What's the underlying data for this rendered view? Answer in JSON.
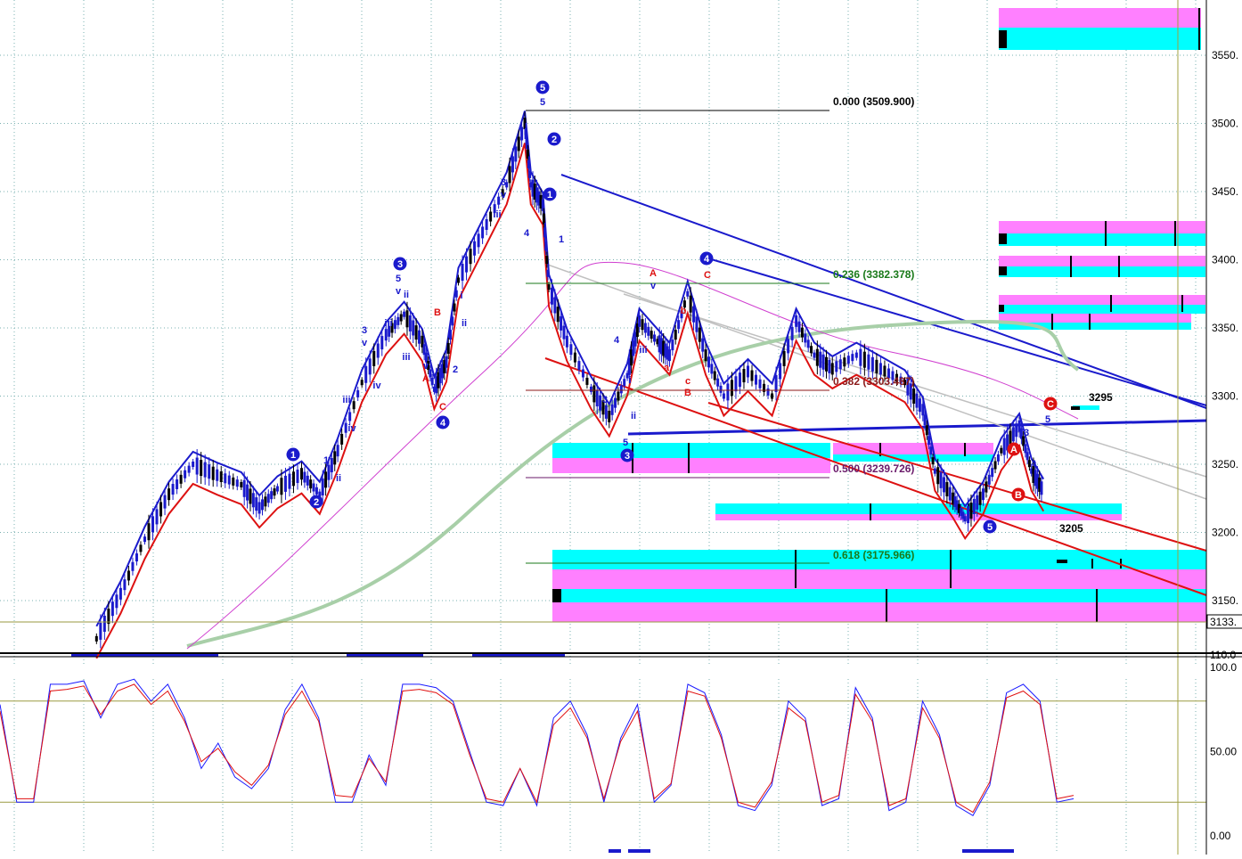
{
  "chart_data": [
    {
      "type": "candlestick",
      "title": "",
      "xlabel": "",
      "ylabel": "",
      "ylim": [
        3118,
        3585
      ],
      "y_ticks": [
        "3550.",
        "3500.",
        "3450.",
        "3400.",
        "3350.",
        "3300.",
        "3250.",
        "3200.",
        "3150."
      ],
      "y_tick_values": [
        3550,
        3500,
        3450,
        3400,
        3350,
        3300,
        3250,
        3200,
        3150
      ],
      "grid": "dotted",
      "current_price_label": "3133.",
      "current_price": 3133,
      "price_series": [
        {
          "x": 0.08,
          "y": 3122
        },
        {
          "x": 0.1,
          "y": 3155
        },
        {
          "x": 0.12,
          "y": 3195
        },
        {
          "x": 0.14,
          "y": 3228
        },
        {
          "x": 0.16,
          "y": 3250
        },
        {
          "x": 0.18,
          "y": 3242
        },
        {
          "x": 0.2,
          "y": 3235
        },
        {
          "x": 0.215,
          "y": 3218
        },
        {
          "x": 0.23,
          "y": 3232
        },
        {
          "x": 0.25,
          "y": 3243
        },
        {
          "x": 0.265,
          "y": 3228
        },
        {
          "x": 0.28,
          "y": 3260
        },
        {
          "x": 0.3,
          "y": 3310
        },
        {
          "x": 0.32,
          "y": 3345
        },
        {
          "x": 0.335,
          "y": 3360
        },
        {
          "x": 0.35,
          "y": 3340
        },
        {
          "x": 0.36,
          "y": 3305
        },
        {
          "x": 0.37,
          "y": 3325
        },
        {
          "x": 0.38,
          "y": 3385
        },
        {
          "x": 0.4,
          "y": 3420
        },
        {
          "x": 0.42,
          "y": 3455
        },
        {
          "x": 0.435,
          "y": 3500
        },
        {
          "x": 0.44,
          "y": 3455
        },
        {
          "x": 0.45,
          "y": 3440
        },
        {
          "x": 0.455,
          "y": 3380
        },
        {
          "x": 0.47,
          "y": 3340
        },
        {
          "x": 0.49,
          "y": 3305
        },
        {
          "x": 0.505,
          "y": 3285
        },
        {
          "x": 0.52,
          "y": 3315
        },
        {
          "x": 0.53,
          "y": 3355
        },
        {
          "x": 0.545,
          "y": 3340
        },
        {
          "x": 0.555,
          "y": 3330
        },
        {
          "x": 0.57,
          "y": 3375
        },
        {
          "x": 0.585,
          "y": 3330
        },
        {
          "x": 0.6,
          "y": 3300
        },
        {
          "x": 0.62,
          "y": 3318
        },
        {
          "x": 0.64,
          "y": 3300
        },
        {
          "x": 0.66,
          "y": 3355
        },
        {
          "x": 0.675,
          "y": 3330
        },
        {
          "x": 0.69,
          "y": 3320
        },
        {
          "x": 0.71,
          "y": 3330
        },
        {
          "x": 0.73,
          "y": 3320
        },
        {
          "x": 0.75,
          "y": 3310
        },
        {
          "x": 0.765,
          "y": 3290
        },
        {
          "x": 0.775,
          "y": 3245
        },
        {
          "x": 0.79,
          "y": 3225
        },
        {
          "x": 0.8,
          "y": 3210
        },
        {
          "x": 0.815,
          "y": 3228
        },
        {
          "x": 0.83,
          "y": 3260
        },
        {
          "x": 0.845,
          "y": 3278
        },
        {
          "x": 0.855,
          "y": 3245
        },
        {
          "x": 0.865,
          "y": 3230
        }
      ],
      "fib_levels": [
        {
          "label": "0.000 (3509.900)",
          "value": 3509.9,
          "color": "#000000"
        },
        {
          "label": "0.236 (3382.378)",
          "value": 3382.378,
          "color": "#1a7a1a"
        },
        {
          "label": "0.382 (3303.487)",
          "value": 3303.487,
          "color": "#8b1a1a"
        },
        {
          "label": "0.500 (3239.726)",
          "value": 3239.726,
          "color": "#6a1a6a"
        },
        {
          "label": "0.618 (3175.966)",
          "value": 3175.966,
          "color": "#1a7a1a"
        }
      ],
      "annotations": [
        "3295",
        "3205"
      ],
      "wave_labels": [
        "1",
        "2",
        "3",
        "4",
        "5",
        "i",
        "ii",
        "iii",
        "iv",
        "v",
        "A",
        "B",
        "C",
        "a",
        "b",
        "c"
      ]
    },
    {
      "type": "line",
      "title": "",
      "ylim": [
        -6,
        106
      ],
      "y_ticks": [
        "100.0",
        "50.00",
        "0.00"
      ],
      "y_tick_values": [
        100,
        50,
        0
      ],
      "axis_top_label": "110.0",
      "levels": [
        80,
        20
      ],
      "series": [
        {
          "color": "#1a1aff",
          "values": [
            78,
            20,
            20,
            90,
            90,
            92,
            70,
            90,
            93,
            80,
            90,
            70,
            40,
            55,
            35,
            28,
            40,
            75,
            90,
            70,
            20,
            20,
            48,
            30,
            90,
            90,
            88,
            80,
            50,
            20,
            18,
            40,
            18,
            70,
            80,
            60,
            20,
            58,
            78,
            20,
            30,
            90,
            85,
            60,
            18,
            15,
            30,
            80,
            70,
            18,
            22,
            88,
            70,
            15,
            20,
            80,
            60,
            18,
            12,
            30,
            85,
            90,
            80,
            20,
            22
          ]
        },
        {
          "color": "#e01010",
          "values": [
            74,
            22,
            22,
            86,
            87,
            89,
            72,
            86,
            90,
            78,
            86,
            68,
            44,
            52,
            38,
            30,
            42,
            72,
            86,
            68,
            24,
            23,
            46,
            32,
            86,
            87,
            85,
            78,
            48,
            22,
            20,
            40,
            20,
            66,
            76,
            58,
            22,
            56,
            74,
            22,
            31,
            86,
            83,
            58,
            20,
            17,
            32,
            76,
            68,
            20,
            24,
            84,
            68,
            18,
            22,
            76,
            58,
            20,
            14,
            32,
            82,
            86,
            78,
            22,
            24
          ]
        }
      ]
    }
  ],
  "colors": {
    "blue": "#1a1acc",
    "red": "#dd1111",
    "cyan": "#00ffff",
    "magenta": "#ff80ff",
    "sage": "#a8cfa8",
    "gray": "#c0c0c0",
    "olive": "#9a9a40"
  }
}
